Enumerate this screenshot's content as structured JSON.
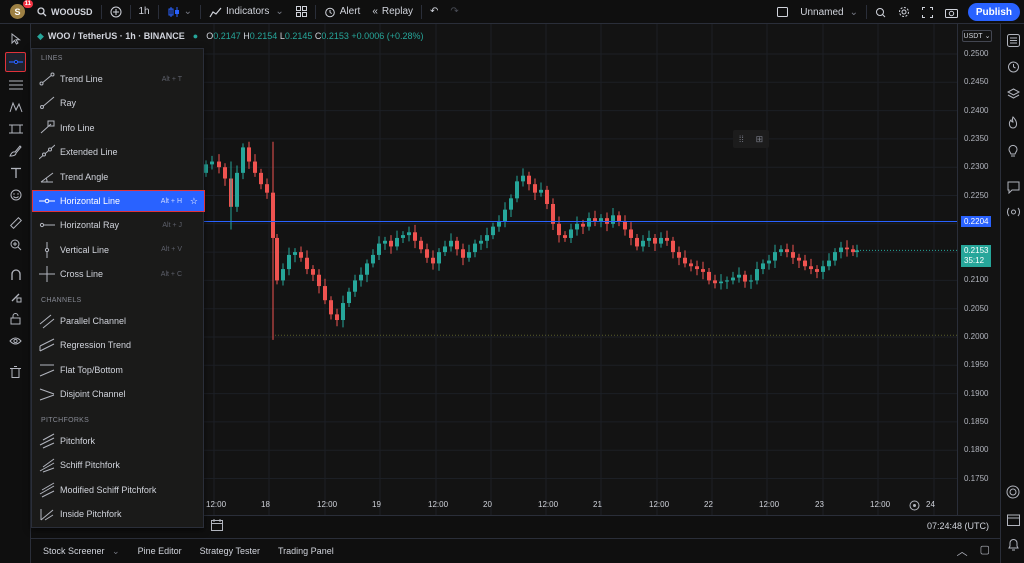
{
  "topbar": {
    "avatar_letter": "S",
    "notification_count": "11",
    "symbol": "WOOUSD",
    "interval": "1h",
    "indicators_label": "Indicators",
    "alert_label": "Alert",
    "replay_label": "Replay",
    "layout_name": "Unnamed",
    "publish_label": "Publish"
  },
  "legend": {
    "symbol_title": "WOO / TetherUS · 1h · BINANCE",
    "o_label": "O",
    "o_value": "0.2147",
    "h_label": "H",
    "h_value": "0.2154",
    "l_label": "L",
    "l_value": "0.2145",
    "c_label": "C",
    "c_value": "0.2153",
    "change": "+0.0006 (+0.28%)",
    "currency_button": "USDT"
  },
  "price_axis": {
    "ticks": [
      "0.2500",
      "0.2450",
      "0.2400",
      "0.2350",
      "0.2300",
      "0.2250",
      "0.2200",
      "0.2150",
      "0.2100",
      "0.2050",
      "0.2000",
      "0.1950",
      "0.1900",
      "0.1850",
      "0.1800",
      "0.1750"
    ],
    "hline_price": "0.2204",
    "last_price": "0.2153",
    "countdown": "35:12"
  },
  "time_axis": {
    "ticks": [
      "12:00",
      "18",
      "12:00",
      "19",
      "12:00",
      "20",
      "12:00",
      "21",
      "12:00",
      "22",
      "12:00",
      "23",
      "12:00",
      "24"
    ],
    "clock": "07:24:48 (UTC)"
  },
  "bottom_tabs": [
    "Stock Screener",
    "Pine Editor",
    "Strategy Tester",
    "Trading Panel"
  ],
  "menu": {
    "sections": {
      "lines": "LINES",
      "channels": "CHANNELS",
      "pitchforks": "PITCHFORKS"
    },
    "lines": [
      {
        "label": "Trend Line",
        "shortcut": "Alt + T"
      },
      {
        "label": "Ray",
        "shortcut": ""
      },
      {
        "label": "Info Line",
        "shortcut": ""
      },
      {
        "label": "Extended Line",
        "shortcut": ""
      },
      {
        "label": "Trend Angle",
        "shortcut": ""
      },
      {
        "label": "Horizontal Line",
        "shortcut": "Alt + H"
      },
      {
        "label": "Horizontal Ray",
        "shortcut": "Alt + J"
      },
      {
        "label": "Vertical Line",
        "shortcut": "Alt + V"
      },
      {
        "label": "Cross Line",
        "shortcut": "Alt + C"
      }
    ],
    "channels": [
      {
        "label": "Parallel Channel"
      },
      {
        "label": "Regression Trend"
      },
      {
        "label": "Flat Top/Bottom"
      },
      {
        "label": "Disjoint Channel"
      }
    ],
    "pitchforks": [
      {
        "label": "Pitchfork"
      },
      {
        "label": "Schiff Pitchfork"
      },
      {
        "label": "Modified Schiff Pitchfork"
      },
      {
        "label": "Inside Pitchfork"
      }
    ],
    "selected": "Horizontal Line"
  },
  "colors": {
    "up": "#26a69a",
    "down": "#ef5350",
    "accent": "#2962ff",
    "highlight_border": "#e0323a"
  }
}
